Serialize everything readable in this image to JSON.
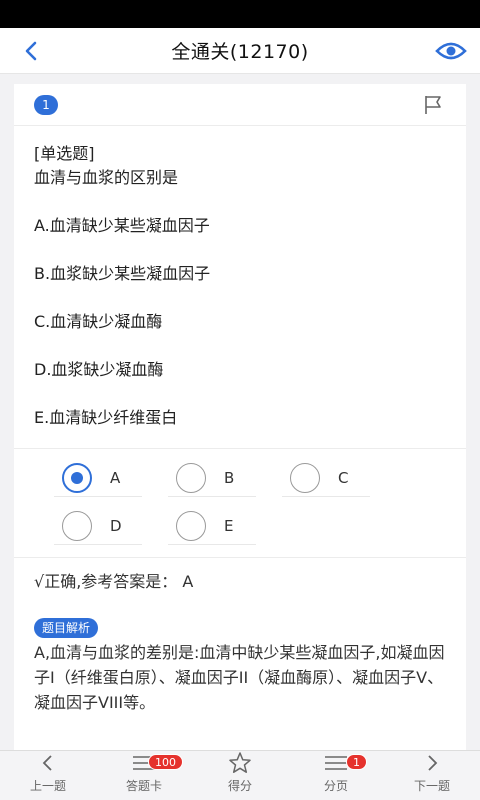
{
  "header": {
    "title": "全通关(12170)"
  },
  "question": {
    "number": "1",
    "type": "[单选题]",
    "text": "血清与血浆的区别是",
    "options": [
      "A.血清缺少某些凝血因子",
      "B.血浆缺少某些凝血因子",
      "C.血清缺少凝血酶",
      "D.血浆缺少凝血酶",
      "E.血清缺少纤维蛋白"
    ]
  },
  "choices": [
    {
      "letter": "A",
      "selected": true
    },
    {
      "letter": "B",
      "selected": false
    },
    {
      "letter": "C",
      "selected": false
    },
    {
      "letter": "D",
      "selected": false
    },
    {
      "letter": "E",
      "selected": false
    }
  ],
  "result": {
    "text": "√正确,参考答案是：  A"
  },
  "analysis": {
    "tag": "题目解析",
    "text": "A,血清与血浆的差别是:血清中缺少某些凝血因子,如凝血因子I（纤维蛋白原）、凝血因子II（凝血酶原）、凝血因子V、凝血因子VIII等。"
  },
  "tabbar": {
    "prev": "上一题",
    "card": "答题卡",
    "card_badge": "100",
    "score": "得分",
    "page": "分页",
    "page_badge": "1",
    "next": "下一题"
  },
  "colors": {
    "accent": "#2f6fd8",
    "badge": "#e5322d"
  }
}
